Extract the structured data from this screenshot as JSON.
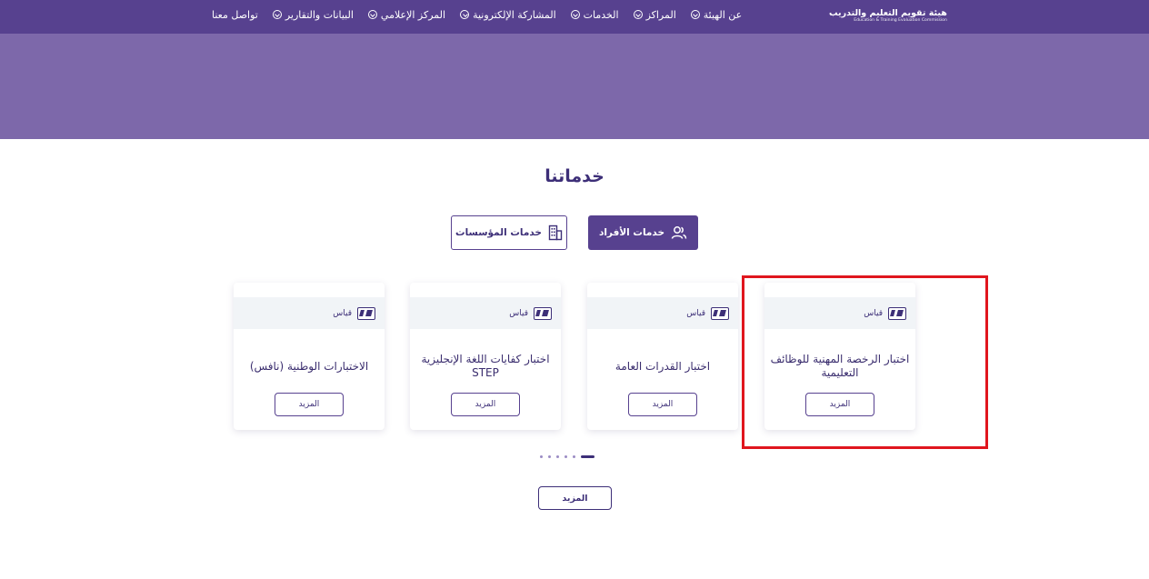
{
  "header": {
    "logo": {
      "arabic": "هيئة تقويم التعليم والتدريب",
      "english": "Education & Training Evaluation Commission"
    },
    "nav": [
      {
        "label": "عن الهيئة",
        "icon": "chevron-down-circle-icon"
      },
      {
        "label": "المراكز",
        "icon": "chevron-down-circle-icon"
      },
      {
        "label": "الخدمات",
        "icon": "chevron-down-circle-icon"
      },
      {
        "label": "المشاركة الإلكترونية",
        "icon": "chevron-down-circle-icon"
      },
      {
        "label": "المركز الإعلامي",
        "icon": "chevron-down-circle-icon"
      },
      {
        "label": "البيانات والتقارير",
        "icon": "chevron-down-circle-icon"
      },
      {
        "label": "تواصل معنا",
        "icon": ""
      }
    ]
  },
  "services": {
    "title": "خدماتنا",
    "tabs": {
      "individuals": {
        "label": "خدمات الأفراد",
        "icon": "users-icon",
        "active": true
      },
      "institutions": {
        "label": "خدمات المؤسسات",
        "icon": "building-icon",
        "active": false
      }
    },
    "cards": [
      {
        "badge": "قياس",
        "title": "اختبار الرخصة المهنية للوظائف التعليمية",
        "button": "المزيد"
      },
      {
        "badge": "قياس",
        "title": "اختبار القدرات العامة",
        "button": "المزيد"
      },
      {
        "badge": "قياس",
        "title": "اختبار كفايات اللغة الإنجليزية STEP",
        "button": "المزيد"
      },
      {
        "badge": "قياس",
        "title": "الاختبارات الوطنية (نافس)",
        "button": "المزيد"
      }
    ],
    "pagination": {
      "total": 6,
      "active_index": 5
    },
    "more_button": "المزيد"
  },
  "colors": {
    "primary": "#57418f",
    "hero": "#7d68aa",
    "highlight": "#e0161e"
  }
}
